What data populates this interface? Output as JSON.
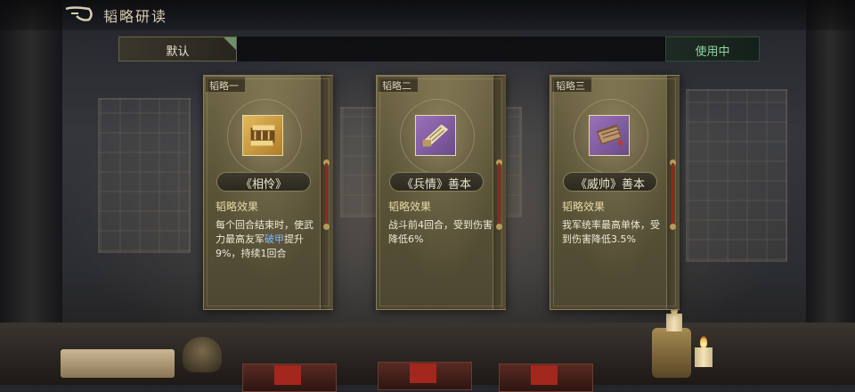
{
  "header": {
    "title": "韬略研读"
  },
  "tabs": {
    "default_label": "默认",
    "in_use_label": "使用中"
  },
  "cards": [
    {
      "tag": "韬略一",
      "name": "《相怜》",
      "effect_title": "韬略效果",
      "effect_parts": [
        "每个回合结束时，使武力最高友军",
        "破甲",
        "提升9%，持续1回合"
      ],
      "icon": "gold-scroll-icon"
    },
    {
      "tag": "韬略二",
      "name": "《兵情》善本",
      "effect_title": "韬略效果",
      "effect_text": "战斗前4回合，受到伤害降低6%",
      "icon": "purple-scroll-icon"
    },
    {
      "tag": "韬略三",
      "name": "《威帅》善本",
      "effect_title": "韬略效果",
      "effect_text": "我军统率最高单体，受到伤害降低3.5%",
      "icon": "purple-book-icon"
    }
  ],
  "colors": {
    "in_use": "#8fd6a4",
    "highlight": "#7fb6ff",
    "card_bg": "#5b5438"
  }
}
